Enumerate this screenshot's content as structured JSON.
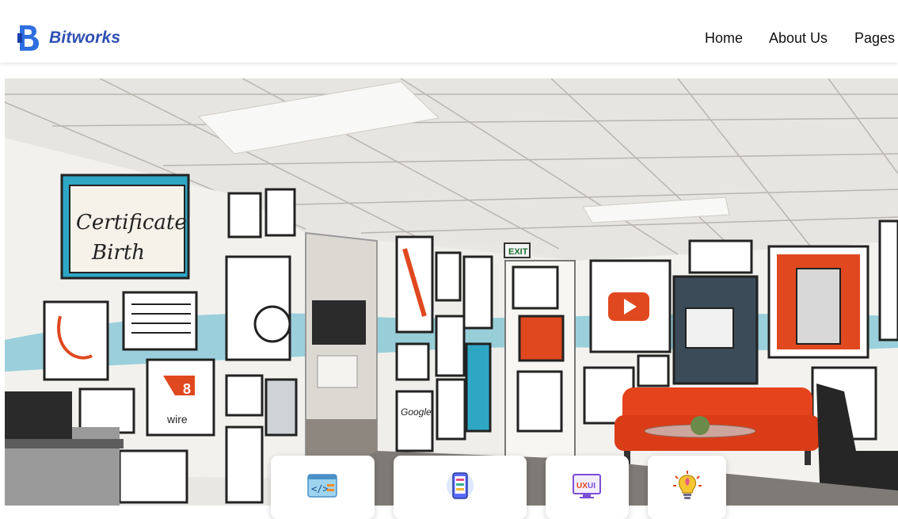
{
  "header": {
    "brand": "Bitworks",
    "logo_icon": "bitworks-logo-icon",
    "brand_color": "#2f4fb3"
  },
  "nav": {
    "items": [
      {
        "label": "Home"
      },
      {
        "label": "About Us"
      },
      {
        "label": "Pages"
      }
    ],
    "dropdown_icon": "chevron-down-icon"
  },
  "hero": {
    "image": "office-lobby-mural-photo",
    "exit_sign": "EXIT",
    "mural_text": {
      "certificate_line1": "Certificate",
      "certificate_line2": "Birth",
      "wire_label": "wire",
      "eight": "8",
      "google": "Google"
    }
  },
  "services": [
    {
      "icon": "code-window-icon"
    },
    {
      "icon": "mobile-app-icon"
    },
    {
      "icon": "ux-ui-design-icon"
    },
    {
      "icon": "lightbulb-idea-icon"
    }
  ],
  "colors": {
    "accent_orange": "#e0481f",
    "mural_teal": "#2ea7c4",
    "sofa": "#e5431c"
  }
}
